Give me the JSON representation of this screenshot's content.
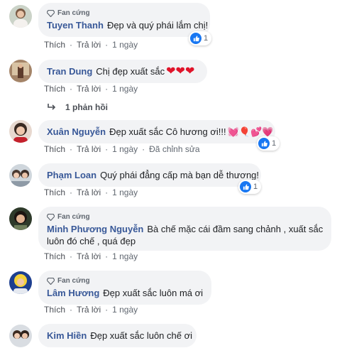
{
  "labels": {
    "fan": "Fan cứng",
    "like": "Thích",
    "reply": "Trả lời",
    "sep": "·"
  },
  "comments": [
    {
      "name": "Tuyen Thanh",
      "text": "Đẹp và quý phái lắm chị!",
      "time": "1 ngày",
      "reactions": "1",
      "edited": ""
    },
    {
      "name": "Tran Dung",
      "text": "Chị đẹp xuất sắc",
      "emoji": "❤❤❤",
      "time": "1 ngày",
      "reply_count": "1 phản hồi"
    },
    {
      "name": "Xuân Nguyễn",
      "text": "Đẹp xuất sắc Cô hương ơi!!!",
      "emoji": "💓🎈💕💗",
      "time": "1 ngày",
      "edited": "Đã chỉnh sửa",
      "reactions": "1"
    },
    {
      "name": "Phạm Loan",
      "text": "Quý phái đẳng cấp mà bạn dễ thương!",
      "time": "1 ngày",
      "reactions": "1"
    },
    {
      "name": "Minh Phương Nguyễn",
      "text_line1": "Bà chế mặc cái đầm sang chảnh , xuất sắc",
      "text_line2": "luôn đó chế , quá đẹp",
      "time": "1 ngày"
    },
    {
      "name": "Lâm Hương",
      "text": "Đẹp xuất sắc luôn má ơi",
      "time": "1 ngày"
    },
    {
      "name": "Kim Hiền",
      "text": "Đẹp xuất sắc luôn chế ơi"
    }
  ]
}
